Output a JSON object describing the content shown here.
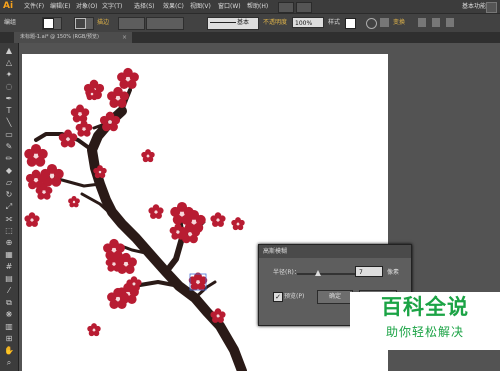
{
  "app": {
    "logo": "Ai",
    "workspace": "基本功能"
  },
  "menu": [
    "文件(F)",
    "编辑(E)",
    "对象(O)",
    "文字(T)",
    "选择(S)",
    "效果(C)",
    "视图(V)",
    "窗口(W)",
    "帮助(H)"
  ],
  "control_bar": {
    "group_label": "编组",
    "stroke_label": "描边",
    "stroke_style": "基本",
    "opacity_label": "不透明度",
    "opacity_value": "100%",
    "style_label": "样式",
    "transform_label": "变换"
  },
  "document_tab": {
    "title": "未标题-1.ai* @ 150% (RGB/预览)",
    "close": "×"
  },
  "dialog": {
    "title": "高斯模糊",
    "radius_label": "半径(R)：",
    "radius_value": "7",
    "radius_unit": "像素",
    "preview_label": "预览(P)",
    "preview_checked": true,
    "ok_label": "确定"
  },
  "watermark": {
    "title": "百科全说",
    "subtitle": "助你轻松解决"
  },
  "colors": {
    "blossom": "#b81c32",
    "branch": "#2a1a17",
    "ai_orange": "#f7a21b",
    "watermark_green": "#1ba345"
  }
}
